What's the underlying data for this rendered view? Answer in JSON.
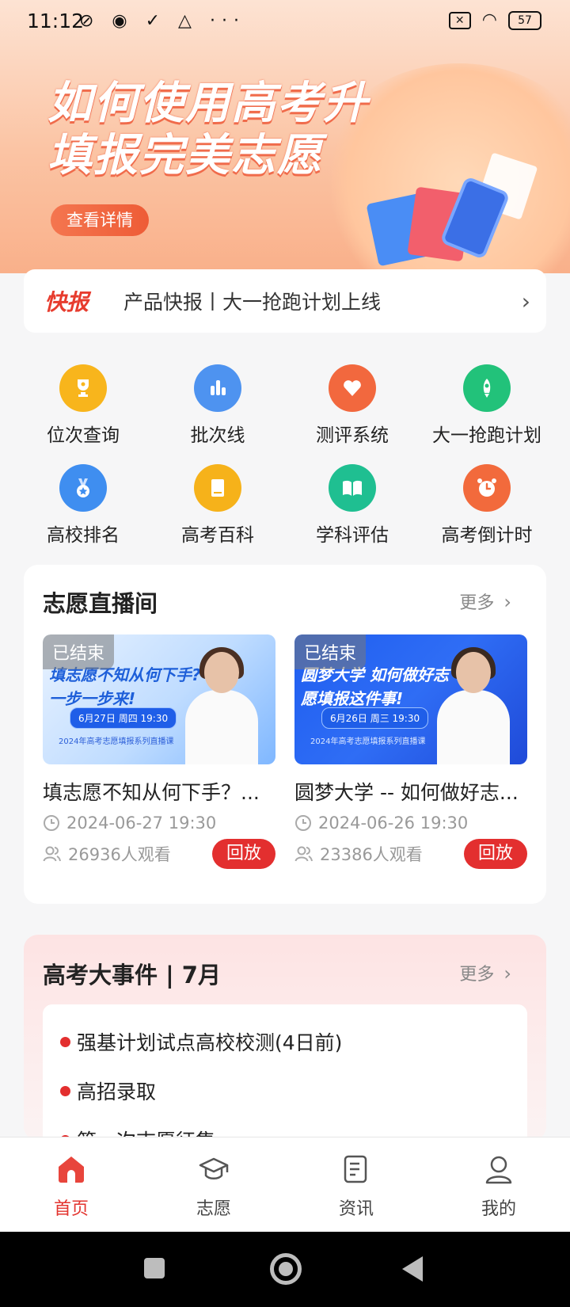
{
  "status_bar": {
    "time": "11:12",
    "icons": "⊘ ◉ ✓ △ ···",
    "battery": "57"
  },
  "banner": {
    "headline_line1": "如何使用高考升",
    "headline_line2": "填报完美志愿",
    "detail_button": "查看详情"
  },
  "news": {
    "tag": "快报",
    "text": "产品快报丨大一抢跑计划上线"
  },
  "grid": [
    {
      "label": "位次查询",
      "icon": "trophy-icon",
      "color": "#f8b51c"
    },
    {
      "label": "批次线",
      "icon": "bar-chart-icon",
      "color": "#4e93f0"
    },
    {
      "label": "测评系统",
      "icon": "heart-icon",
      "color": "#f2683e"
    },
    {
      "label": "大一抢跑计划",
      "icon": "rocket-icon",
      "color": "#22c27a"
    },
    {
      "label": "高校排名",
      "icon": "medal-icon",
      "color": "#3f8ef0"
    },
    {
      "label": "高考百科",
      "icon": "book-icon",
      "color": "#f6b21a"
    },
    {
      "label": "学科评估",
      "icon": "open-book-icon",
      "color": "#1fbf91"
    },
    {
      "label": "高考倒计时",
      "icon": "alarm-clock-icon",
      "color": "#f26a3c"
    }
  ],
  "live": {
    "title": "志愿直播间",
    "more": "更多",
    "items": [
      {
        "status": "已结束",
        "thumb_text": "填志愿不知从何下手? 一步一步来!",
        "thumb_date": "6月27日 周四 19:30",
        "thumb_footer": "2024年高考志愿填报系列直播课",
        "title": "填志愿不知从何下手？...",
        "time": "2024-06-27 19:30",
        "viewers": "26936人观看",
        "replay": "回放"
      },
      {
        "status": "已结束",
        "thumb_text": "圆梦大学 如何做好志愿填报这件事!",
        "thumb_date": "6月26日 周三 19:30",
        "thumb_footer": "2024年高考志愿填报系列直播课",
        "title": "圆梦大学 -- 如何做好志...",
        "time": "2024-06-26 19:30",
        "viewers": "23386人观看",
        "replay": "回放"
      }
    ]
  },
  "events": {
    "title": "高考大事件 | 7月",
    "more": "更多",
    "items": [
      "强基计划试点高校校测(4日前)",
      "高招录取",
      "第一次志愿征集"
    ]
  },
  "tabs": [
    {
      "label": "首页",
      "active": true
    },
    {
      "label": "志愿",
      "active": false
    },
    {
      "label": "资讯",
      "active": false
    },
    {
      "label": "我的",
      "active": false
    }
  ]
}
